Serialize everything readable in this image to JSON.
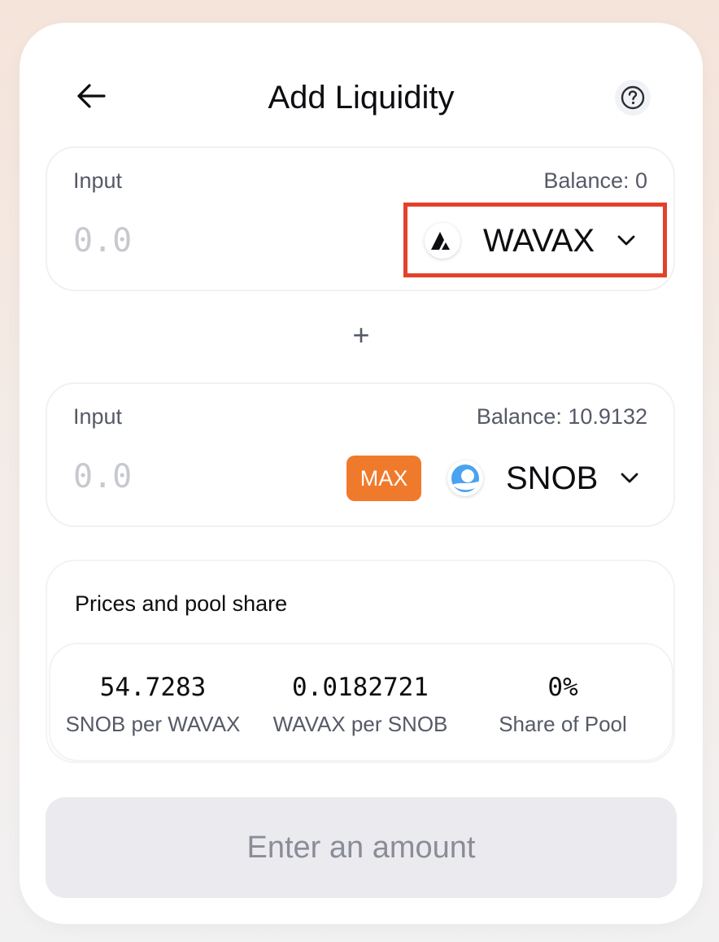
{
  "header": {
    "title": "Add Liquidity"
  },
  "input_a": {
    "label": "Input",
    "balance": "Balance: 0",
    "placeholder": "0.0",
    "token": "WAVAX",
    "token_icon": "avalanche-icon"
  },
  "separator": "+",
  "input_b": {
    "label": "Input",
    "balance": "Balance: 10.9132",
    "placeholder": "0.0",
    "max_label": "MAX",
    "token": "SNOB",
    "token_icon": "snowball-icon"
  },
  "prices": {
    "title": "Prices and pool share",
    "items": [
      {
        "value": "54.7283",
        "label": "SNOB per WAVAX"
      },
      {
        "value": "0.0182721",
        "label": "WAVAX per SNOB"
      },
      {
        "value": "0%",
        "label": "Share of Pool"
      }
    ]
  },
  "submit": {
    "label": "Enter an amount"
  },
  "colors": {
    "max_button": "#f07a2b",
    "highlight": "#e3412b",
    "submit_bg": "#ebebef"
  }
}
